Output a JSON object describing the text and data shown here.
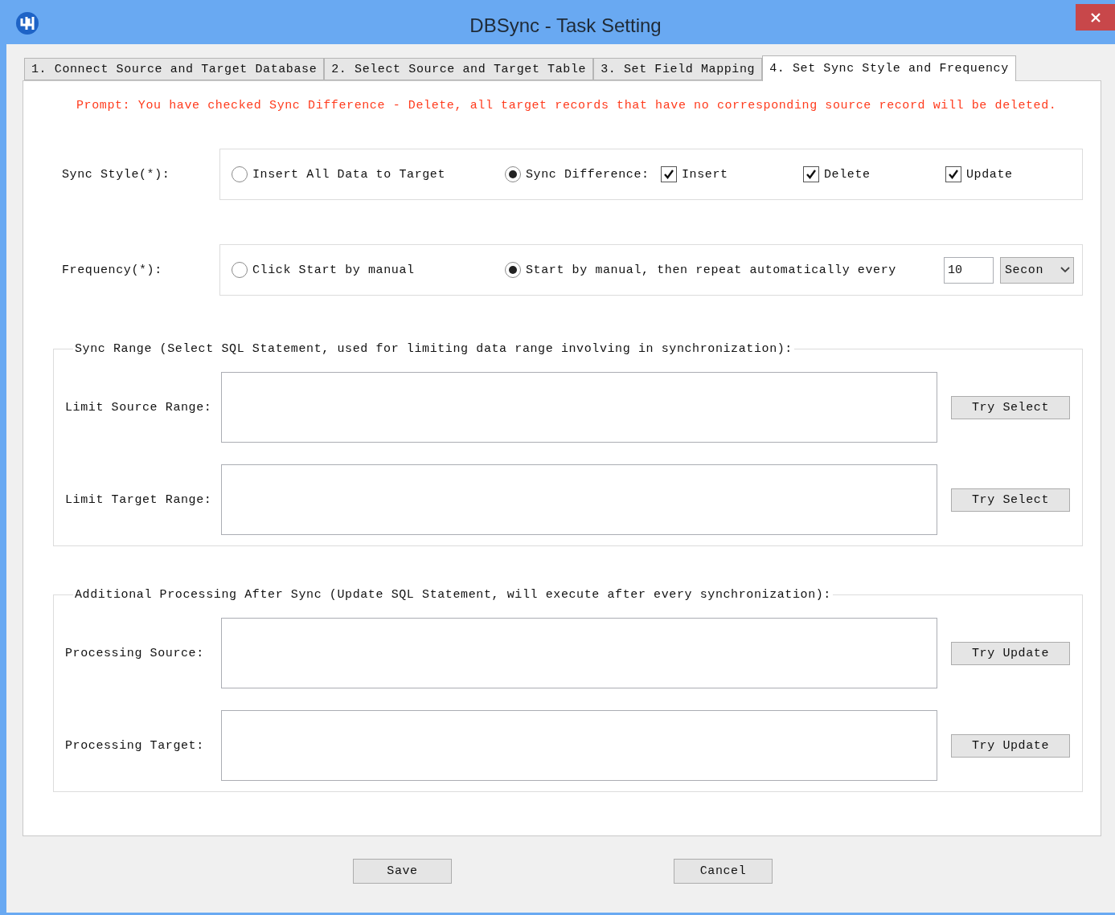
{
  "window": {
    "title": "DBSync - Task Setting"
  },
  "tabs": [
    {
      "label": "1. Connect Source and Target Database",
      "selected": false
    },
    {
      "label": "2. Select Source and Target Table",
      "selected": false
    },
    {
      "label": "3. Set Field Mapping",
      "selected": false
    },
    {
      "label": "4. Set Sync Style and Frequency",
      "selected": true
    }
  ],
  "prompt": "Prompt: You have checked Sync Difference - Delete, all target records that have no corresponding source record will be deleted.",
  "sync_style": {
    "label": "Sync Style(*):",
    "options": [
      {
        "label": "Insert All Data to Target",
        "selected": false
      },
      {
        "label": "Sync Difference:",
        "selected": true
      }
    ],
    "checkboxes": [
      {
        "label": "Insert",
        "checked": true
      },
      {
        "label": "Delete",
        "checked": true
      },
      {
        "label": "Update",
        "checked": true
      }
    ]
  },
  "frequency": {
    "label": "Frequency(*):",
    "options": [
      {
        "label": "Click Start by manual",
        "selected": false
      },
      {
        "label": "Start by manual, then repeat automatically every",
        "selected": true
      }
    ],
    "interval": "10",
    "unit": "Secon"
  },
  "groups": [
    {
      "title": "Sync Range (Select SQL Statement, used for limiting data range involving in synchronization):",
      "rows": [
        {
          "label": "Limit Source Range:",
          "button": "Try Select"
        },
        {
          "label": "Limit Target Range:",
          "button": "Try Select"
        }
      ]
    },
    {
      "title": "Additional Processing After Sync (Update SQL Statement, will execute after every synchronization):",
      "rows": [
        {
          "label": "Processing Source:",
          "button": "Try Update"
        },
        {
          "label": "Processing Target:",
          "button": "Try Update"
        }
      ]
    }
  ],
  "buttons": [
    "Save",
    "Cancel"
  ]
}
